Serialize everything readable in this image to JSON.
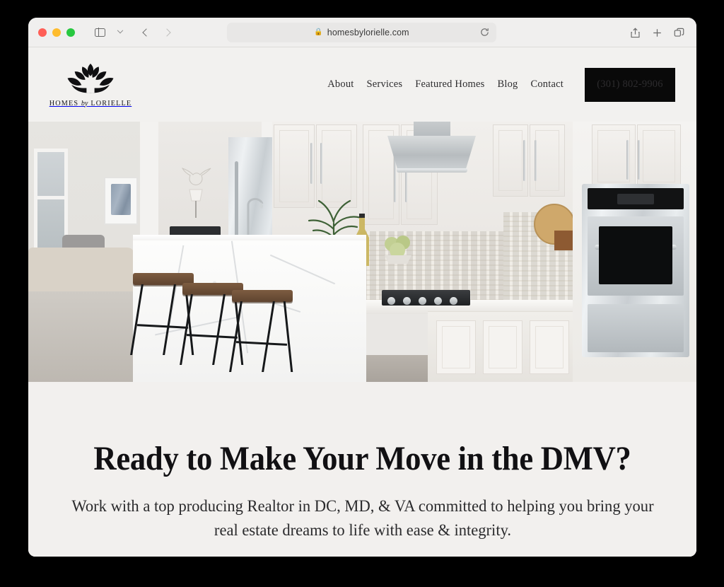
{
  "browser": {
    "traffic_lights": [
      "close",
      "minimize",
      "maximize"
    ],
    "sidebar_toggle": "sidebar-toggle",
    "tab_group_chevron": "chevron-down",
    "back": "back-arrow",
    "forward": "forward-arrow",
    "url": "homesbylorielle.com",
    "lock": "🔒",
    "reload": "reload-icon",
    "share": "share-icon",
    "new_tab": "plus-icon",
    "tabs_overview": "tabs-icon"
  },
  "site": {
    "brand": {
      "logo": "lotus-house-logo",
      "word_1": "HOMES",
      "word_by": "by",
      "word_2": "LORIELLE"
    },
    "nav": [
      {
        "label": "About"
      },
      {
        "label": "Services"
      },
      {
        "label": "Featured Homes"
      },
      {
        "label": "Blog"
      },
      {
        "label": "Contact"
      }
    ],
    "phone_button": {
      "label": "(301) 802-9906",
      "bg": "#090909",
      "color": "#ffffff"
    },
    "hero": {
      "alt": "modern white kitchen with marble waterfall island, three wooden bar stools, stainless double wall oven and range hood"
    },
    "cta": {
      "heading": "Ready to Make Your Move in the DMV?",
      "subheading": "Work with a top producing Realtor in DC, MD, & VA committed to helping you bring your real estate dreams to life with ease & integrity."
    }
  },
  "colors": {
    "page_bg": "#f2f1ef",
    "cta_bg": "#f2f0ee",
    "accent_dark": "#090909",
    "text": "#111013",
    "backdrop": "#000000"
  }
}
